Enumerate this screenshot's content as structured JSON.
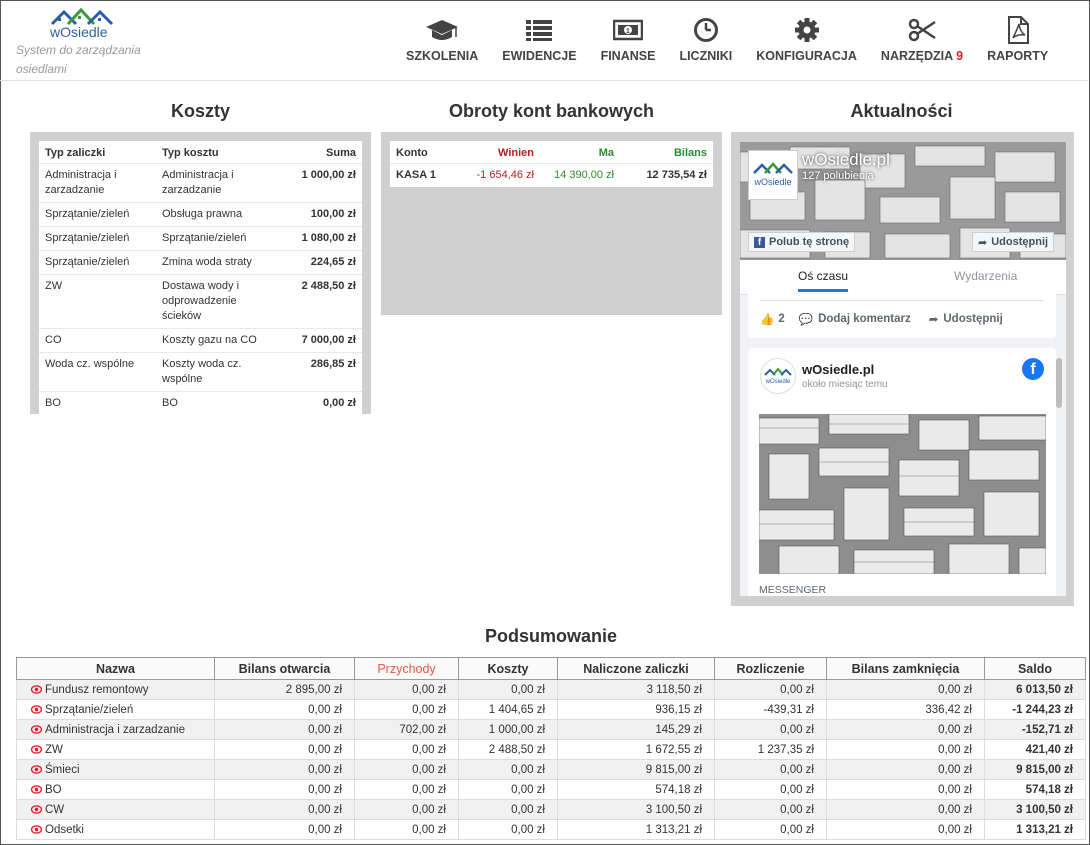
{
  "header": {
    "logo_text": "wOsiedle",
    "tagline": "System do zarządzania osiedlami",
    "nav": [
      {
        "label": "SZKOLENIA",
        "icon": "graduation-cap-icon"
      },
      {
        "label": "EWIDENCJE",
        "icon": "list-icon"
      },
      {
        "label": "FINANSE",
        "icon": "money-icon"
      },
      {
        "label": "LICZNIKI",
        "icon": "clock-icon"
      },
      {
        "label": "KONFIGURACJA",
        "icon": "gear-icon"
      },
      {
        "label": "NARZĘDZIA",
        "count": "9",
        "icon": "scissors-icon"
      },
      {
        "label": "RAPORTY",
        "icon": "pdf-file-icon"
      }
    ]
  },
  "costs": {
    "title": "Koszty",
    "headers": {
      "advance_type": "Typ zaliczki",
      "cost_type": "Typ kosztu",
      "sum": "Suma"
    },
    "rows": [
      {
        "advance": "Administracja i zarzadzanie",
        "cost": "Administracja i zarzadzanie",
        "sum": "1 000,00 zł"
      },
      {
        "advance": "Sprzątanie/zieleń",
        "cost": "Obsługa prawna",
        "sum": "100,00 zł"
      },
      {
        "advance": "Sprzątanie/zieleń",
        "cost": "Sprzątanie/zieleń",
        "sum": "1 080,00 zł"
      },
      {
        "advance": "Sprzątanie/zieleń",
        "cost": "Zmina woda straty",
        "sum": "224,65 zł"
      },
      {
        "advance": "ZW",
        "cost": "Dostawa wody i odprowadzenie ścieków",
        "sum": "2 488,50 zł"
      },
      {
        "advance": "CO",
        "cost": "Koszty gazu na CO",
        "sum": "7 000,00 zł"
      },
      {
        "advance": "Woda cz. wspólne",
        "cost": "Koszty woda cz. wspólne",
        "sum": "286,85 zł"
      },
      {
        "advance": "BO",
        "cost": "BO",
        "sum": "0,00 zł"
      }
    ]
  },
  "bank": {
    "title": "Obroty kont bankowych",
    "headers": {
      "account": "Konto",
      "debit": "Winien",
      "credit": "Ma",
      "balance": "Bilans"
    },
    "rows": [
      {
        "account": "KASA 1",
        "debit": "-1 654,46 zł",
        "credit": "14 390,00 zł",
        "balance": "12 735,54 zł"
      }
    ],
    "colors": {
      "debit": "#b22222",
      "credit": "#2e8b2e"
    }
  },
  "news": {
    "title": "Aktualności",
    "page_name": "wOsiedle.pl",
    "likes": "127 polubienia",
    "like_button": "Polub tę stronę",
    "share_button": "Udostępnij",
    "tabs": [
      "Oś czasu",
      "Wydarzenia"
    ],
    "post_actions": {
      "likes": "2",
      "comment": "Dodaj komentarz",
      "share": "Udostępnij"
    },
    "post": {
      "author": "wOsiedle.pl",
      "time": "około miesiąc temu",
      "footer": "MESSENGER"
    },
    "logo_text": "wOsiedle",
    "fb_color": "#1877f2"
  },
  "summary": {
    "title": "Podsumowanie",
    "headers": [
      "Nazwa",
      "Bilans otwarcia",
      "Przychody",
      "Koszty",
      "Naliczone zaliczki",
      "Rozliczenie",
      "Bilans zamknięcia",
      "Saldo"
    ],
    "highlight_header_color": "#e05a47",
    "rows": [
      {
        "name": "Fundusz remontowy",
        "opening": "2 895,00 zł",
        "income": "0,00 zł",
        "costs": "0,00 zł",
        "advances": "3 118,50 zł",
        "settlement": "0,00 zł",
        "closing": "0,00 zł",
        "balance": "6 013,50 zł"
      },
      {
        "name": "Sprzątanie/zieleń",
        "opening": "0,00 zł",
        "income": "0,00 zł",
        "costs": "1 404,65 zł",
        "advances": "936,15 zł",
        "settlement": "-439,31 zł",
        "closing": "336,42 zł",
        "balance": "-1 244,23 zł"
      },
      {
        "name": "Administracja i zarzadzanie",
        "opening": "0,00 zł",
        "income": "702,00 zł",
        "costs": "1 000,00 zł",
        "advances": "145,29 zł",
        "settlement": "0,00 zł",
        "closing": "0,00 zł",
        "balance": "-152,71 zł"
      },
      {
        "name": "ZW",
        "opening": "0,00 zł",
        "income": "0,00 zł",
        "costs": "2 488,50 zł",
        "advances": "1 672,55 zł",
        "settlement": "1 237,35 zł",
        "closing": "0,00 zł",
        "balance": "421,40 zł"
      },
      {
        "name": "Śmieci",
        "opening": "0,00 zł",
        "income": "0,00 zł",
        "costs": "0,00 zł",
        "advances": "9 815,00 zł",
        "settlement": "0,00 zł",
        "closing": "0,00 zł",
        "balance": "9 815,00 zł"
      },
      {
        "name": "BO",
        "opening": "0,00 zł",
        "income": "0,00 zł",
        "costs": "0,00 zł",
        "advances": "574,18 zł",
        "settlement": "0,00 zł",
        "closing": "0,00 zł",
        "balance": "574,18 zł"
      },
      {
        "name": "CW",
        "opening": "0,00 zł",
        "income": "0,00 zł",
        "costs": "0,00 zł",
        "advances": "3 100,50 zł",
        "settlement": "0,00 zł",
        "closing": "0,00 zł",
        "balance": "3 100,50 zł"
      },
      {
        "name": "Odsetki",
        "opening": "0,00 zł",
        "income": "0,00 zł",
        "costs": "0,00 zł",
        "advances": "1 313,21 zł",
        "settlement": "0,00 zł",
        "closing": "0,00 zł",
        "balance": "1 313,21 zł"
      }
    ]
  },
  "theme": {
    "eye_color": "#d9262c",
    "logo_green": "#3a9a3a",
    "logo_blue": "#2b5fa8"
  }
}
